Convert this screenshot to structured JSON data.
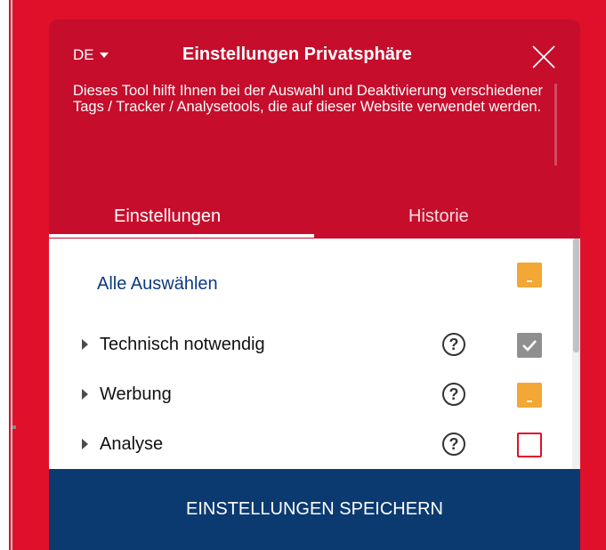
{
  "modal": {
    "language": "DE",
    "title": "Einstellungen Privatsphäre",
    "description": "Dieses Tool hilft Ihnen bei der Auswahl und Deaktivierung verschiedener Tags / Tracker / Analysetools, die auf dieser Website verwendet werden.",
    "tabs": [
      {
        "label": "Einstellungen",
        "active": true
      },
      {
        "label": "Historie",
        "active": false
      }
    ],
    "select_all": {
      "label": "Alle Auswählen",
      "state": "partial"
    },
    "categories": [
      {
        "label": "Technisch notwendig",
        "help": "?",
        "state": "checked"
      },
      {
        "label": "Werbung",
        "help": "?",
        "state": "partial"
      },
      {
        "label": "Analyse",
        "help": "?",
        "state": "unchecked"
      }
    ],
    "save_label": "EINSTELLUNGEN SPEICHERN"
  },
  "colors": {
    "background": "#e0102a",
    "modal": "#c60d2c",
    "accent_orange": "#f3a734",
    "save_button": "#0b3a70",
    "link_blue": "#0b3a80"
  }
}
